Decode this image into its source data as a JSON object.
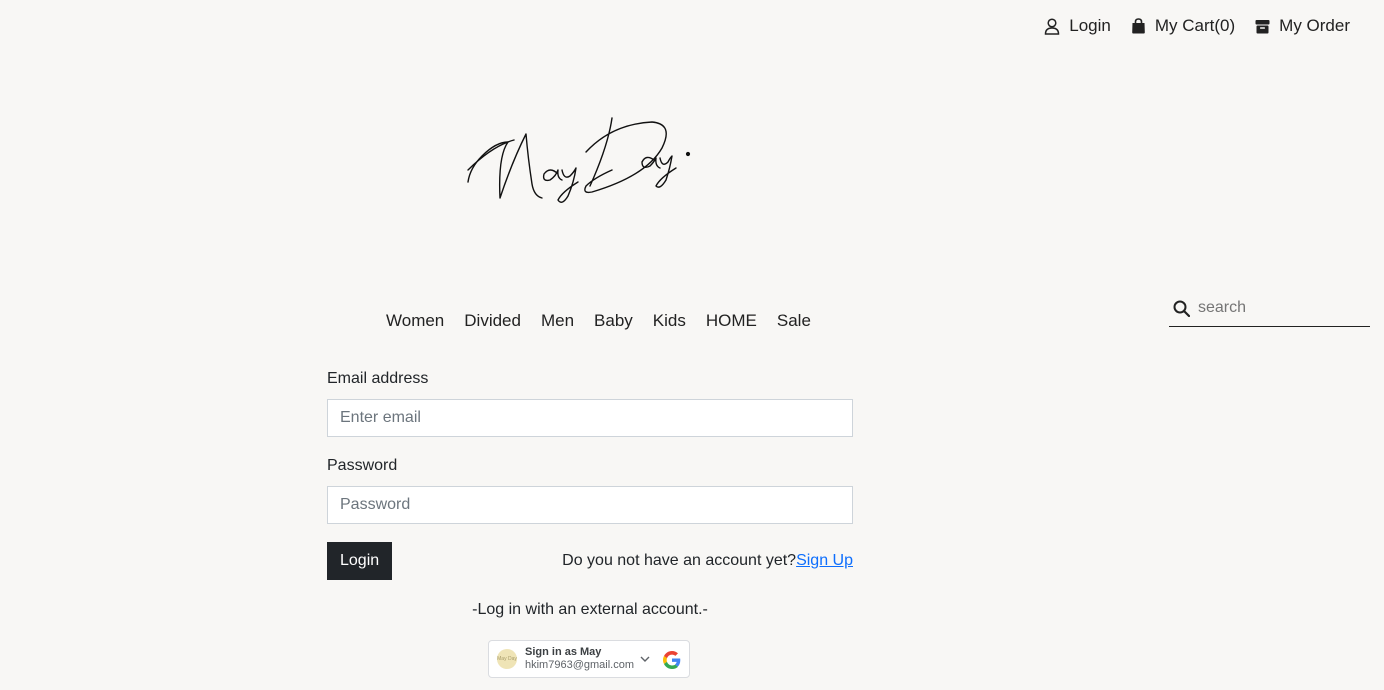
{
  "topbar": {
    "login_label": "Login",
    "cart_label": "My Cart(0)",
    "order_label": "My Order"
  },
  "logo": {
    "alt": "May Day."
  },
  "nav": {
    "items": [
      {
        "label": "Women"
      },
      {
        "label": "Divided"
      },
      {
        "label": "Men"
      },
      {
        "label": "Baby"
      },
      {
        "label": "Kids"
      },
      {
        "label": "HOME"
      },
      {
        "label": "Sale"
      }
    ]
  },
  "search": {
    "placeholder": "search",
    "value": ""
  },
  "form": {
    "email_label": "Email address",
    "email_placeholder": "Enter email",
    "password_label": "Password",
    "password_placeholder": "Password",
    "login_button": "Login",
    "signup_prompt": "Do you not have an account yet?",
    "signup_link": "Sign Up"
  },
  "external": {
    "text": "-Log in with an external account.-"
  },
  "google": {
    "name": "Sign in as May",
    "email": "hkim7963@gmail.com",
    "avatar_text": "May Day"
  },
  "colors": {
    "background": "#f8f7f5",
    "button_dark": "#212529",
    "link": "#0d6efd"
  }
}
